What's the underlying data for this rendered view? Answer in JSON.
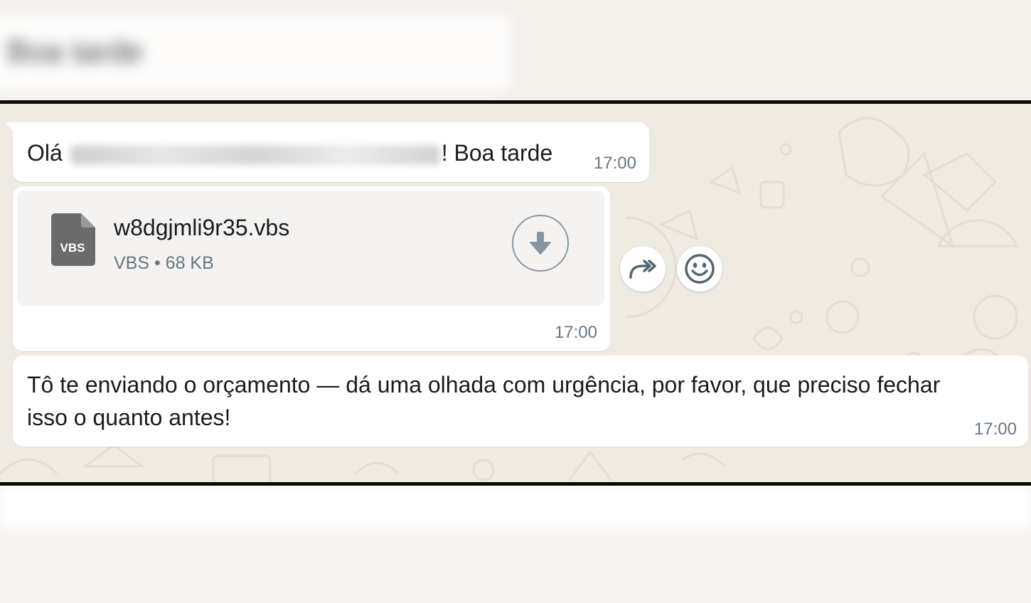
{
  "messages": {
    "greeting": {
      "prefix": "Olá",
      "suffix": "! Boa tarde",
      "time": "17:00"
    },
    "document": {
      "filename": "w8dgjmli9r35.vbs",
      "badge": "VBS",
      "meta": "VBS • 68 KB",
      "time": "17:00"
    },
    "body": {
      "text": "Tô te enviando o orçamento — dá uma olhada com urgência, por favor, que preciso fechar isso o quanto antes!",
      "time": "17:00"
    }
  },
  "blurred_header": {
    "text": "Boa tarde"
  },
  "colors": {
    "chat_background": "#efeae2",
    "bubble": "#ffffff",
    "doc_card": "#f5f3f1",
    "timestamp": "#667781",
    "icon_gray": "#8696a0",
    "doc_icon": "#6b6b6b"
  },
  "icons": {
    "document": "file-vbs-icon",
    "download": "download-arrow-icon",
    "forward": "forward-icon",
    "react": "smiley-icon"
  }
}
